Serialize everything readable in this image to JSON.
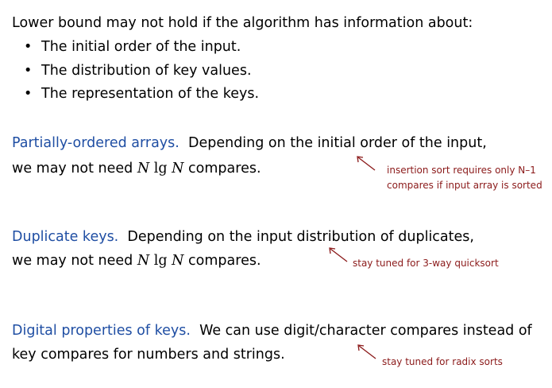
{
  "intro": {
    "heading": "Lower bound may not hold if the algorithm has information about:",
    "bullets": [
      "The initial order of the input.",
      "The distribution of key values.",
      "The representation of the keys."
    ]
  },
  "sections": [
    {
      "title": "Partially-ordered arrays.",
      "line1": "Depending on the initial order of the input,",
      "line2_pre": "we may not need",
      "n1": "N",
      "lg": "lg",
      "n2": "N",
      "line2_post": "compares.",
      "note_lines": [
        "insertion sort requires only N–1",
        "compares if input array is sorted"
      ]
    },
    {
      "title": "Duplicate keys.",
      "line1": "Depending on the input distribution of duplicates,",
      "line2_pre": "we may not need",
      "n1": "N",
      "lg": "lg",
      "n2": "N",
      "line2_post": "compares.",
      "note_lines": [
        "stay tuned for 3-way quicksort"
      ]
    },
    {
      "title": "Digital properties of keys.",
      "line1": "We can use digit/character compares instead of",
      "line2": "key compares for numbers and strings.",
      "note_lines": [
        "stay tuned for radix sorts"
      ]
    }
  ],
  "colors": {
    "title_blue": "#1f4ea3",
    "note_red": "#8b1a1a"
  }
}
